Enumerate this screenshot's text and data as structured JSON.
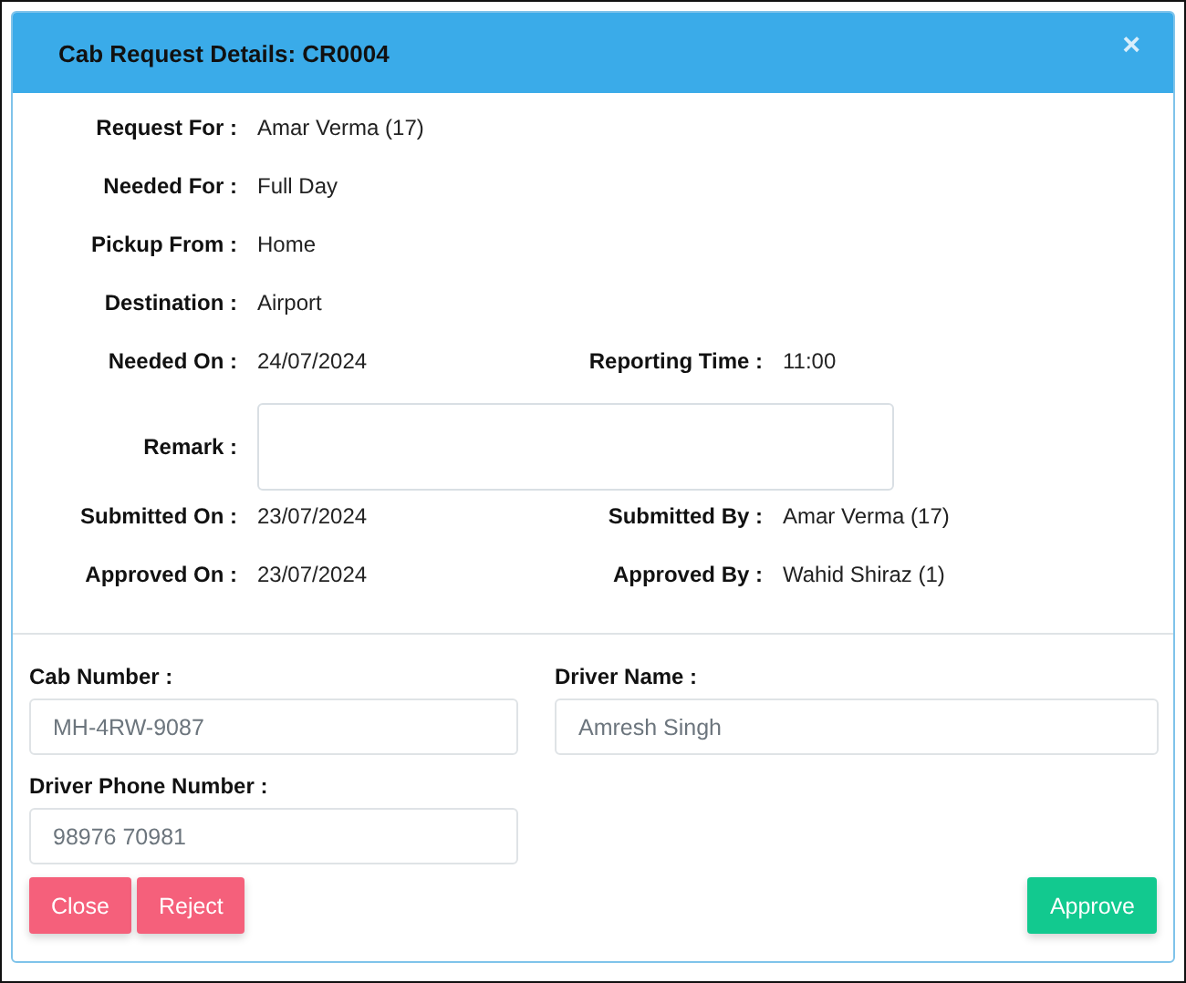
{
  "dialog": {
    "title": "Cab Request Details: CR0004",
    "close_glyph": "×"
  },
  "details": [
    {
      "kind": "pair",
      "items": [
        {
          "label": "Request For :",
          "value": "Amar Verma (17)"
        }
      ]
    },
    {
      "kind": "pair",
      "items": [
        {
          "label": "Needed For :",
          "value": "Full Day"
        }
      ]
    },
    {
      "kind": "pair",
      "items": [
        {
          "label": "Pickup From :",
          "value": "Home"
        }
      ]
    },
    {
      "kind": "pair",
      "items": [
        {
          "label": "Destination :",
          "value": "Airport"
        }
      ]
    },
    {
      "kind": "pair",
      "items": [
        {
          "label": "Needed On :",
          "value": "24/07/2024"
        },
        {
          "label": "Reporting Time :",
          "value": "11:00"
        }
      ]
    },
    {
      "kind": "box",
      "items": [
        {
          "label": "Remark :"
        }
      ]
    },
    {
      "kind": "pair",
      "items": [
        {
          "label": "Submitted On :",
          "value": "23/07/2024"
        },
        {
          "label": "Submitted By :",
          "value": "Amar Verma (17)"
        }
      ]
    },
    {
      "kind": "pair",
      "items": [
        {
          "label": "Approved On :",
          "value": "23/07/2024"
        },
        {
          "label": "Approved By :",
          "value": "Wahid Shiraz (1)"
        }
      ]
    }
  ],
  "fields": [
    {
      "label": "Cab Number :",
      "value": "MH-4RW-9087"
    },
    {
      "label": "Driver Name :",
      "value": "Amresh Singh"
    },
    {
      "label": "Driver Phone Number :",
      "value": "98976 70981"
    }
  ],
  "buttons": [
    {
      "label": "Close",
      "kind": "danger"
    },
    {
      "label": "Reject",
      "kind": "danger"
    },
    {
      "label": "Approve",
      "kind": "success"
    }
  ]
}
